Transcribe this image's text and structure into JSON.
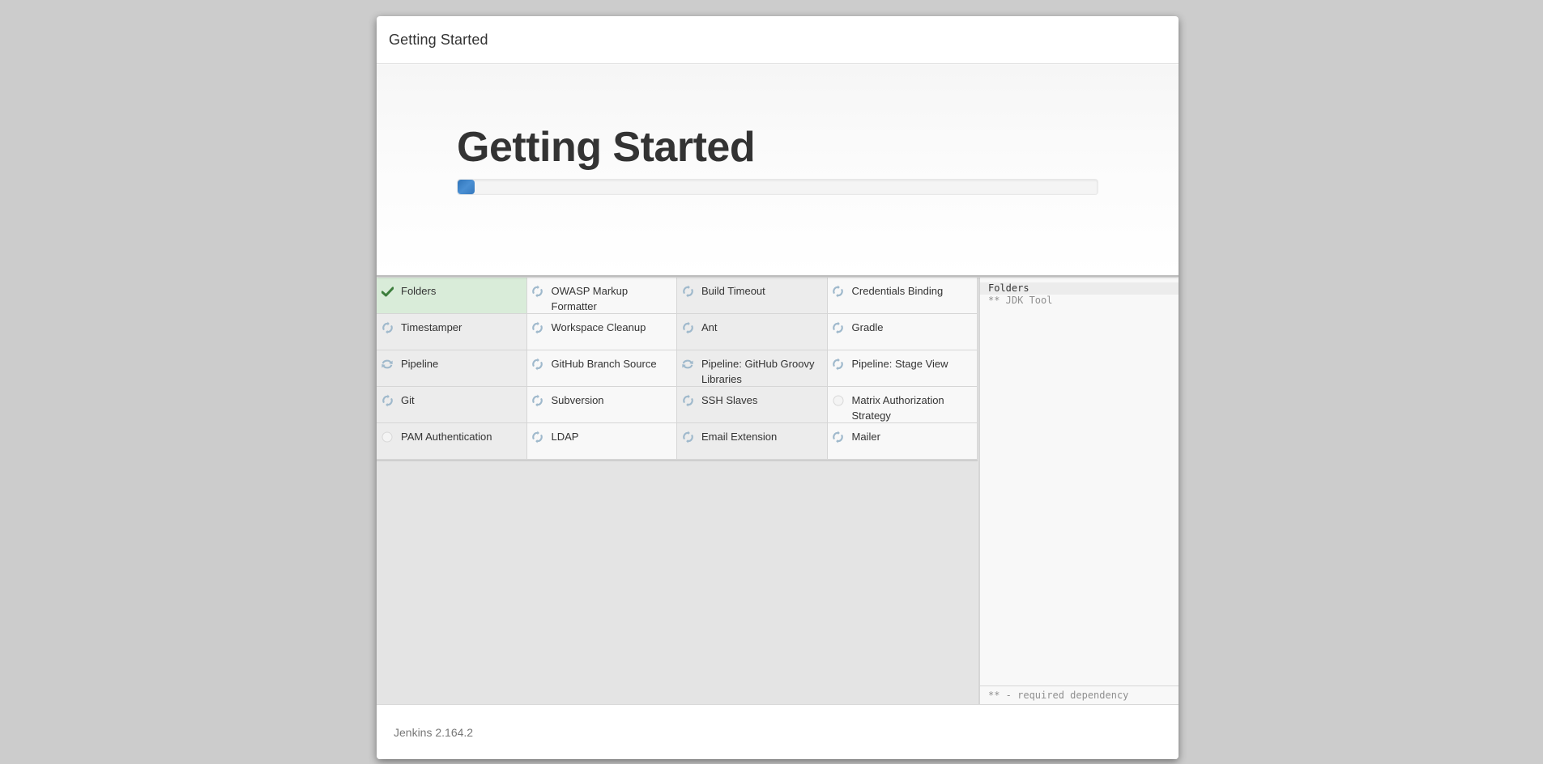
{
  "dialog": {
    "header_title": "Getting Started",
    "hero_title": "Getting Started",
    "progress_percent": 2.7,
    "footer_version": "Jenkins 2.164.2"
  },
  "colors": {
    "progress": "#3578bd",
    "success_bg": "#d9ecd9",
    "success_icon": "#3b7d3b",
    "pending_icon": "#9fb9cc"
  },
  "plugins": [
    {
      "name": "Folders",
      "status": "success",
      "icon": "checkmark-icon"
    },
    {
      "name": "OWASP Markup Formatter",
      "status": "installing",
      "icon": "spinner-icon"
    },
    {
      "name": "Build Timeout",
      "status": "installing",
      "icon": "spinner-icon"
    },
    {
      "name": "Credentials Binding",
      "status": "installing",
      "icon": "spinner-icon"
    },
    {
      "name": "Timestamper",
      "status": "installing",
      "icon": "spinner-icon"
    },
    {
      "name": "Workspace Cleanup",
      "status": "installing",
      "icon": "spinner-icon"
    },
    {
      "name": "Ant",
      "status": "installing",
      "icon": "spinner-icon"
    },
    {
      "name": "Gradle",
      "status": "installing",
      "icon": "spinner-icon"
    },
    {
      "name": "Pipeline",
      "status": "installing",
      "icon": "refresh-icon"
    },
    {
      "name": "GitHub Branch Source",
      "status": "installing",
      "icon": "spinner-icon"
    },
    {
      "name": "Pipeline: GitHub Groovy Libraries",
      "status": "installing",
      "icon": "refresh-icon"
    },
    {
      "name": "Pipeline: Stage View",
      "status": "installing",
      "icon": "spinner-icon"
    },
    {
      "name": "Git",
      "status": "installing",
      "icon": "spinner-icon"
    },
    {
      "name": "Subversion",
      "status": "installing",
      "icon": "spinner-icon"
    },
    {
      "name": "SSH Slaves",
      "status": "installing",
      "icon": "spinner-icon"
    },
    {
      "name": "Matrix Authorization Strategy",
      "status": "pending",
      "icon": "circle-icon"
    },
    {
      "name": "PAM Authentication",
      "status": "pending",
      "icon": "circle-icon"
    },
    {
      "name": "LDAP",
      "status": "installing",
      "icon": "spinner-icon"
    },
    {
      "name": "Email Extension",
      "status": "installing",
      "icon": "spinner-icon"
    },
    {
      "name": "Mailer",
      "status": "installing",
      "icon": "spinner-icon"
    }
  ],
  "log": {
    "lines": [
      {
        "text": "Folders",
        "kind": "current"
      },
      {
        "text": "** JDK Tool",
        "kind": "dep"
      }
    ],
    "footer_note": "** - required dependency"
  }
}
